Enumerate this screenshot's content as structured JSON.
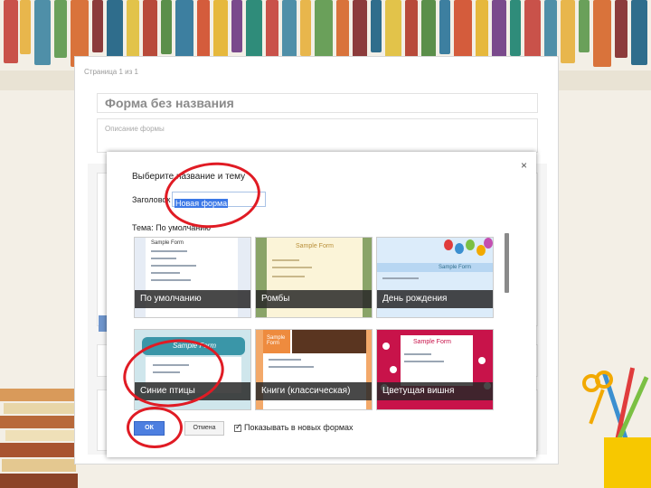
{
  "form": {
    "page_indicator": "Страница 1 из 1",
    "title": "Форма без названия",
    "description_placeholder": "Описание формы"
  },
  "dialog": {
    "title": "Выберите название и тему",
    "heading_label": "Заголовок",
    "heading_value": "Новая форма",
    "theme_label": "Тема: По умолчанию",
    "close_symbol": "×",
    "themes": [
      {
        "label": "По умолчанию",
        "sample": "Sample Form"
      },
      {
        "label": "Ромбы",
        "sample": "Sample Form"
      },
      {
        "label": "День рождения",
        "sample": "Sample Form"
      },
      {
        "label": "Синие птицы",
        "sample": "Sample Form"
      },
      {
        "label": "Книги (классическая)",
        "sample": "Sample Form"
      },
      {
        "label": "Цветущая вишня",
        "sample": "Sample Form"
      }
    ],
    "ok_label": "ОК",
    "cancel_label": "Отмена",
    "show_in_new_forms_label": "Показывать в новых формах",
    "show_in_new_forms_checked": true
  },
  "colors": {
    "highlight": "#e01b24",
    "primary_button": "#4d7fe0"
  }
}
